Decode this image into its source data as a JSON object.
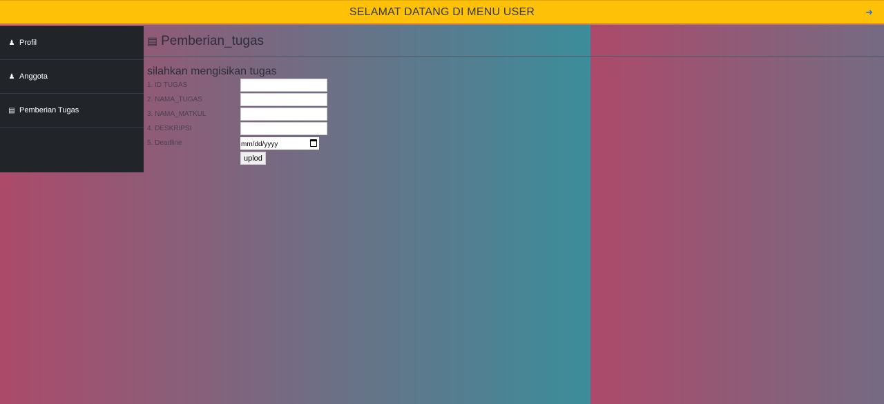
{
  "header": {
    "title": "SELAMAT DATANG DI MENU USER",
    "logout_icon": "sign-out-icon"
  },
  "sidebar": {
    "items": [
      {
        "label": "Profil",
        "icon": "user-icon"
      },
      {
        "label": "Anggota",
        "icon": "users-icon"
      },
      {
        "label": "Pemberian Tugas",
        "icon": "list-alt-icon"
      }
    ]
  },
  "main": {
    "title": "Pemberian_tugas",
    "subtitle": "silahkan mengisikan tugas",
    "fields": [
      {
        "label": "1. ID TUGAS",
        "value": ""
      },
      {
        "label": "2. NAMA_TUGAS",
        "value": ""
      },
      {
        "label": "3. NAMA_MATKUL",
        "value": ""
      },
      {
        "label": "4. DESKRIPSI",
        "value": ""
      },
      {
        "label": "5. Deadline",
        "placeholder": "mm/dd/yyyy"
      }
    ],
    "submit_label": "uplod"
  },
  "colors": {
    "header": "#ffc107",
    "sidebar": "#212529",
    "gradient_start": "#ac4a6a",
    "gradient_end": "#3b8d9b"
  }
}
